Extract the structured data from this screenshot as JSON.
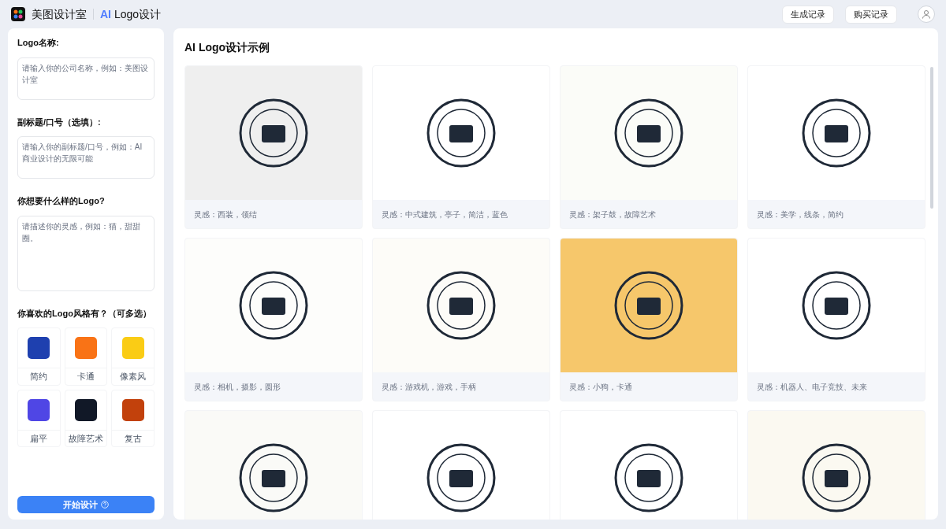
{
  "header": {
    "brand": "美图设计室",
    "product_ai": "AI",
    "product_name": "Logo设计",
    "buttons": [
      "生成记录",
      "购买记录"
    ]
  },
  "form": {
    "fields": [
      {
        "label": "Logo名称:",
        "placeholder": "请输入你的公司名称，例如：美图设计室"
      },
      {
        "label": "副标题/口号（选填）:",
        "placeholder": "请输入你的副标题/口号，例如：AI商业设计的无限可能"
      },
      {
        "label": "你想要什么样的Logo?",
        "placeholder": "请描述你的灵感，例如：猫，甜甜圈。"
      }
    ],
    "styles_label": "你喜欢的Logo风格有？（可多选）",
    "styles": [
      {
        "name": "简约",
        "selected": false,
        "color": "#1e40af"
      },
      {
        "name": "卡通",
        "selected": false,
        "color": "#f97316"
      },
      {
        "name": "像素风",
        "selected": false,
        "color": "#facc15"
      },
      {
        "name": "扁平",
        "selected": false,
        "color": "#4f46e5"
      },
      {
        "name": "故障艺术",
        "selected": false,
        "color": "#111827"
      },
      {
        "name": "复古",
        "selected": false,
        "color": "#c2410c"
      }
    ],
    "submit": "开始设计"
  },
  "gallery": {
    "title": "AI Logo设计示例",
    "cards": [
      {
        "caption": "灵感：西装，领结",
        "color": "#efefef"
      },
      {
        "caption": "灵感：中式建筑，亭子，简洁，蓝色",
        "color": "#ffffff"
      },
      {
        "caption": "灵感：架子鼓，故障艺术",
        "color": "#fbfcf8"
      },
      {
        "caption": "灵感：美学，线条，简约",
        "color": "#ffffff"
      },
      {
        "caption": "灵感：相机，摄影，圆形",
        "color": "#fdfdfb"
      },
      {
        "caption": "灵感：游戏机，游戏，手柄",
        "color": "#fdfcf8"
      },
      {
        "caption": "灵感：小狗，卡通",
        "color": "#f6c76b"
      },
      {
        "caption": "灵感：机器人、电子竞技、未来",
        "color": "#ffffff"
      },
      {
        "color": "#fafaf7"
      },
      {
        "color": "#ffffff"
      },
      {
        "color": "#ffffff"
      },
      {
        "color": "#fbf9f1"
      }
    ]
  }
}
